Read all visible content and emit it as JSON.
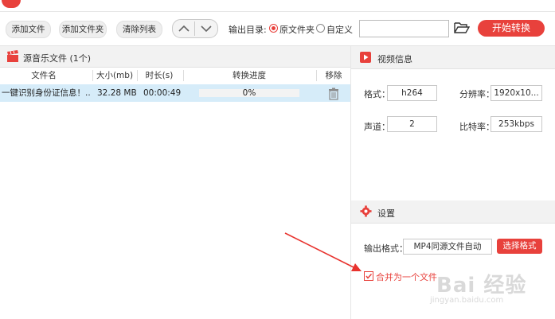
{
  "toolbar": {
    "add_file": "添加文件",
    "add_folder": "添加文件夹",
    "clear_list": "清除列表",
    "output_dir_label": "输出目录:",
    "radio_original": "原文件夹",
    "radio_custom": "自定义",
    "output_path_value": "",
    "start_convert": "开始转换"
  },
  "file_list": {
    "title": "源音乐文件 (1个)",
    "columns": [
      "文件名",
      "大小(mb)",
      "时长(s)",
      "转换进度",
      "移除"
    ],
    "rows": [
      {
        "name": "一键识别身份证信息！....",
        "size": "32.28 MB",
        "duration": "00:00:49",
        "progress": "0%",
        "progress_value": 0
      }
    ]
  },
  "video_info": {
    "title": "视频信息",
    "format_label": "格式：",
    "format_value": "h264",
    "resolution_label": "分辨率：",
    "resolution_value": "1920x10...",
    "channels_label": "声道：",
    "channels_value": "2",
    "bitrate_label": "比特率：",
    "bitrate_value": "253kbps"
  },
  "settings": {
    "title": "设置",
    "output_format_label": "输出格式：",
    "output_format_value": "MP4同源文件自动",
    "choose_format": "选择格式",
    "merge_label": "合并为一个文件",
    "merge_checked": true
  },
  "watermark": {
    "brand": "Bai 经验",
    "url": "jingyan.baidu.com"
  },
  "colors": {
    "accent": "#e8413c",
    "selected_row": "#d6ecf9",
    "annotation_arrow": "#e8332e"
  }
}
